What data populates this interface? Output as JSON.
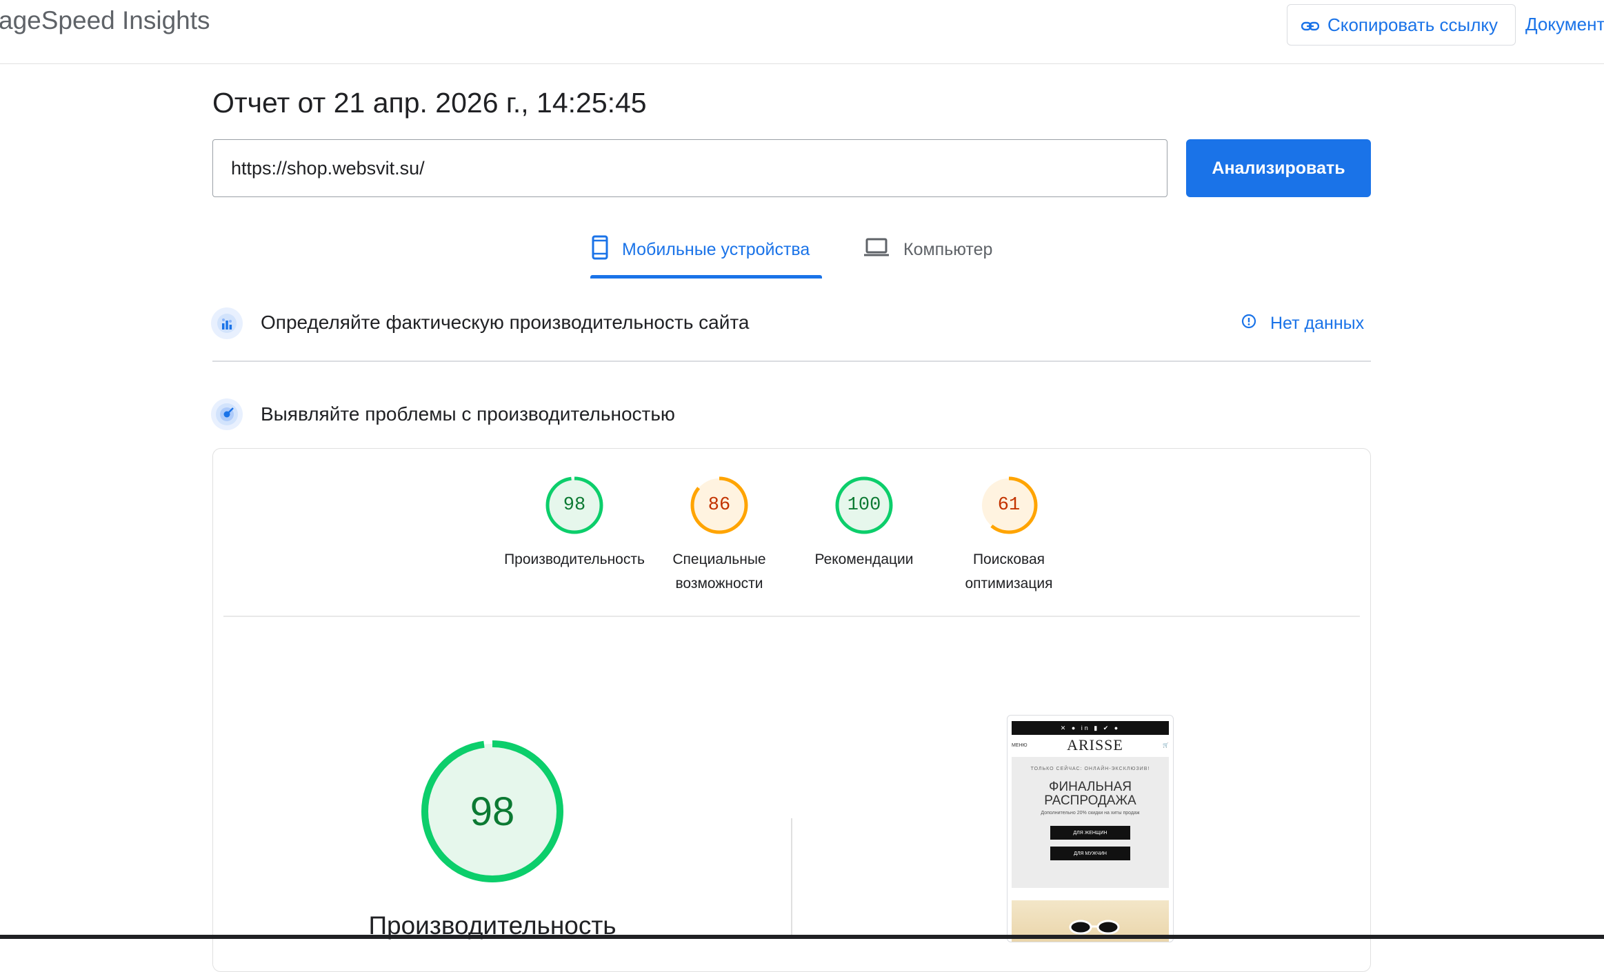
{
  "header": {
    "brand": "ageSpeed Insights",
    "copy_link_label": "Скопировать ссылку",
    "docs_label": "Документ"
  },
  "report": {
    "title": "Отчет от 21 апр. 2026 г., 14:25:45",
    "url_value": "https://shop.websvit.su/",
    "analyze_label": "Анализировать"
  },
  "tabs": [
    {
      "label": "Мобильные устройства",
      "icon": "smartphone-icon",
      "active": true
    },
    {
      "label": "Компьютер",
      "icon": "laptop-icon",
      "active": false
    }
  ],
  "field_section": {
    "title": "Определяйте фактическую производительность сайта",
    "status": "Нет данных"
  },
  "lab_section": {
    "title": "Выявляйте проблемы с производительностью"
  },
  "scores": [
    {
      "value": "98",
      "label_line1": "Производительность",
      "label_line2": "",
      "color": "#0cce6b",
      "text_color": "#0c7a33",
      "bg": "#e6f7ec"
    },
    {
      "value": "86",
      "label_line1": "Специальные",
      "label_line2": "возможности",
      "color": "#ffa400",
      "text_color": "#c33300",
      "bg": "#fff3e0"
    },
    {
      "value": "100",
      "label_line1": "Рекомендации",
      "label_line2": "",
      "color": "#0cce6b",
      "text_color": "#0c7a33",
      "bg": "#e6f7ec"
    },
    {
      "value": "61",
      "label_line1": "Поисковая",
      "label_line2": "оптимизация",
      "color": "#ffa400",
      "text_color": "#c33300",
      "bg": "#fff3e0"
    }
  ],
  "main_score": {
    "value": "98",
    "label": "Производительность",
    "color": "#0cce6b"
  },
  "screenshot": {
    "menu": "МЕНЮ",
    "logo": "ARISSE",
    "small": "ТОЛЬКО СЕЙЧАС: ОНЛАЙН-ЭКСКЛЮЗИВ!",
    "title_line1": "ФИНАЛЬНАЯ",
    "title_line2": "РАСПРОДАЖА",
    "subtitle": "Дополнительно 20% скидки на хиты продаж",
    "btn_women": "ДЛЯ ЖЕНЩИН",
    "btn_men": "ДЛЯ МУЖЧИН"
  }
}
